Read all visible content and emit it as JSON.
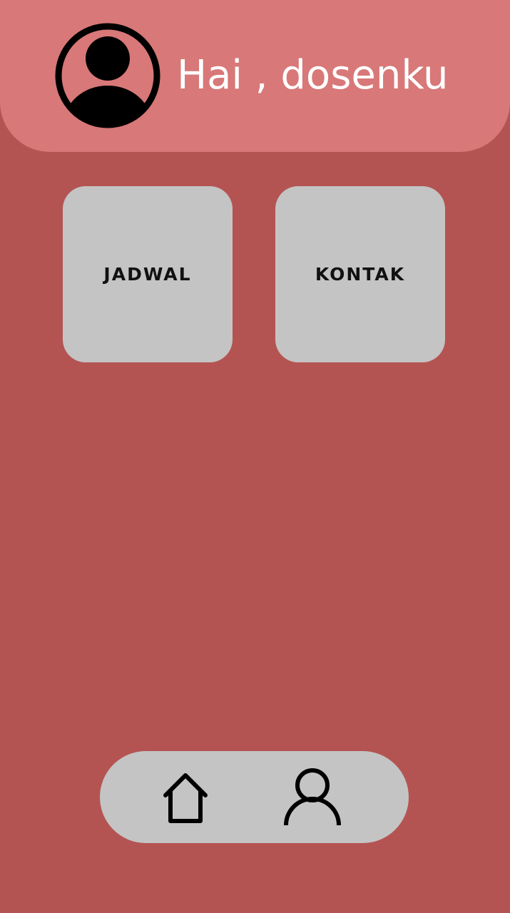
{
  "header": {
    "greeting": "Hai , dosenku",
    "avatar_icon": "user-circle-icon"
  },
  "menu": {
    "tiles": [
      {
        "label": "JADWAL"
      },
      {
        "label": "KONTAK"
      }
    ]
  },
  "bottom_nav": {
    "items": [
      {
        "icon": "home-icon"
      },
      {
        "icon": "person-icon"
      }
    ]
  },
  "colors": {
    "background": "#b45452",
    "header": "#d87878",
    "tile": "#c4c4c4",
    "text_light": "#ffffff",
    "text_dark": "#111111"
  }
}
